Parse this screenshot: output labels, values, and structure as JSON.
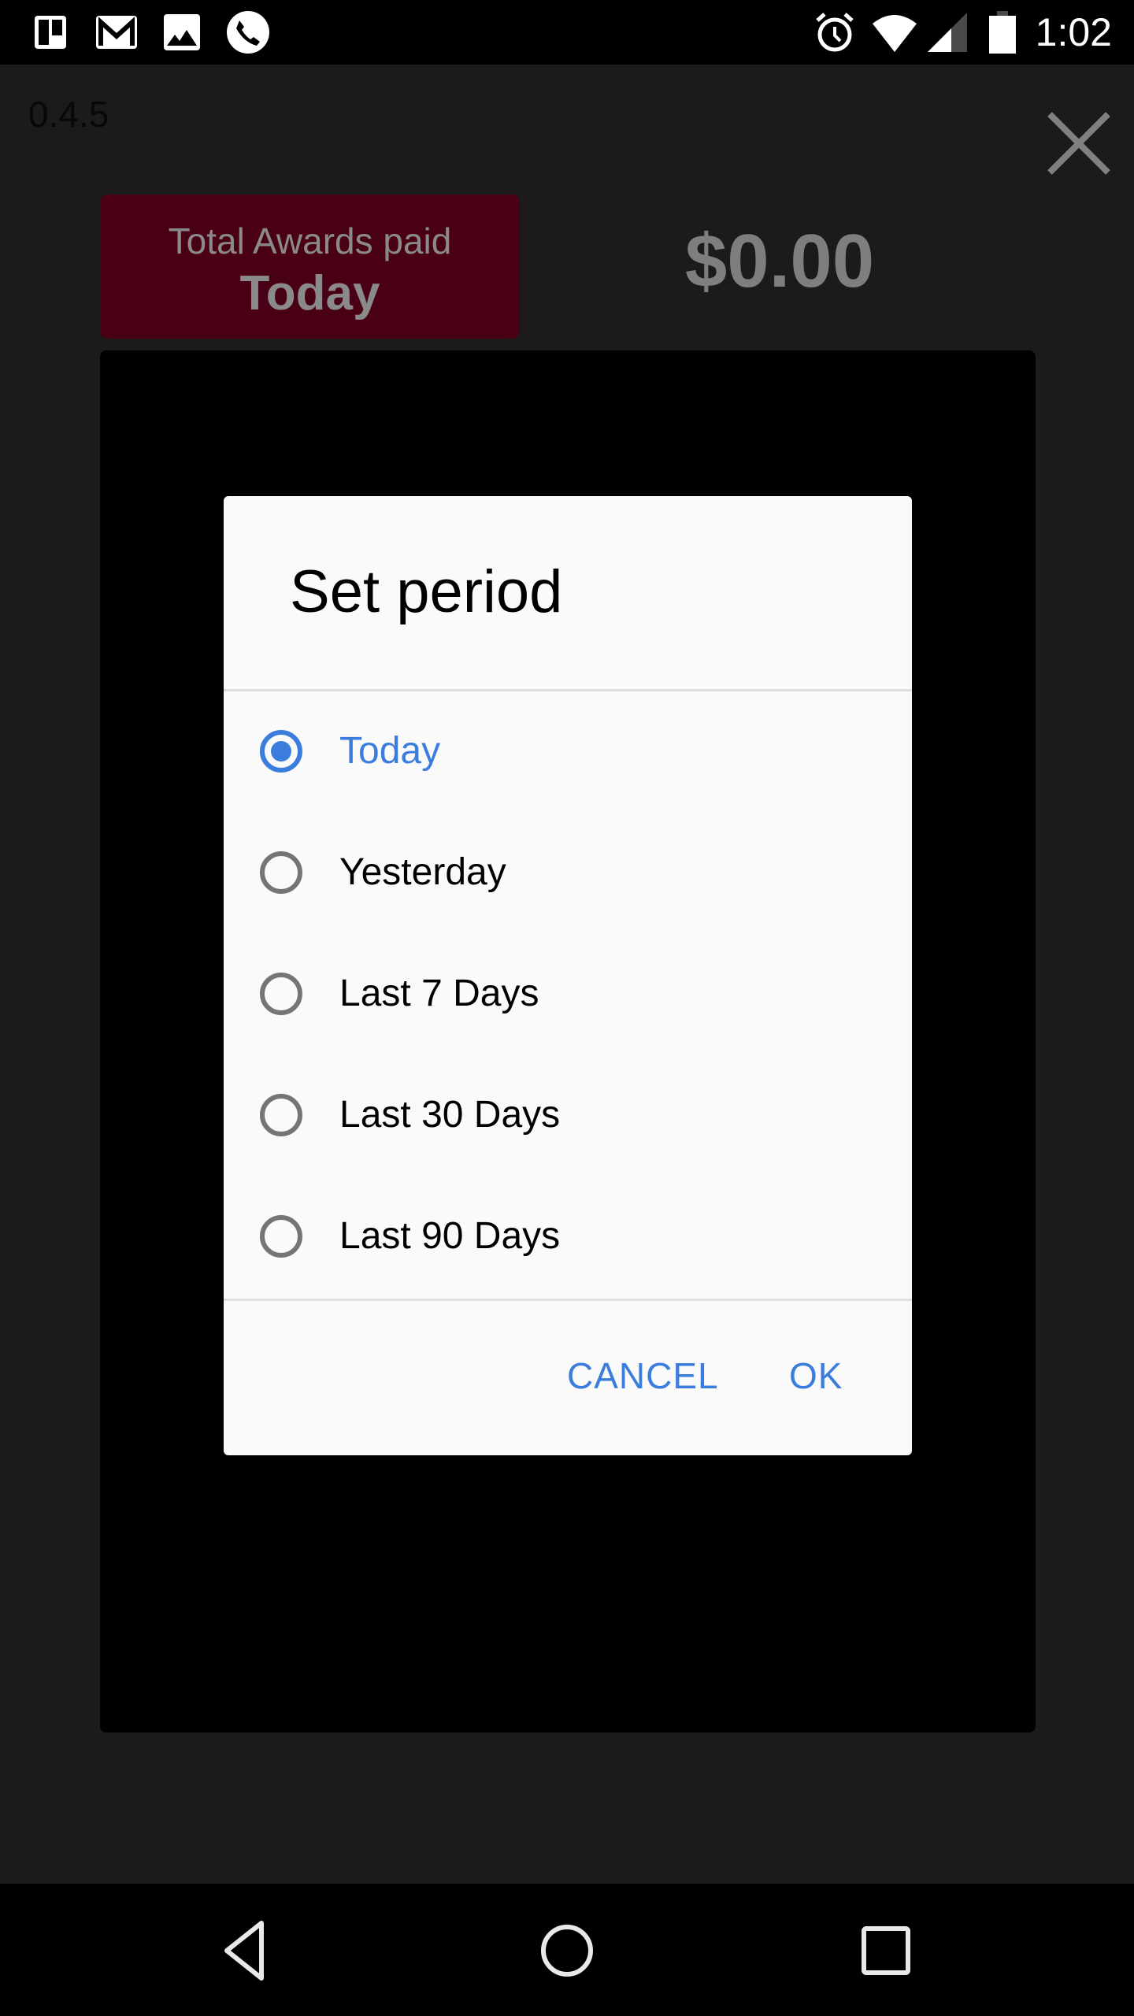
{
  "status_bar": {
    "left_icons": [
      "trello-icon",
      "gmail-icon",
      "gallery-icon",
      "phone-call-icon"
    ],
    "right_icons": [
      "alarm-icon",
      "wifi-icon",
      "cell-signal-icon",
      "battery-icon"
    ],
    "time": "1:02"
  },
  "app": {
    "version": "0.4.5",
    "banner": {
      "label": "Total Awards paid",
      "period": "Today"
    },
    "amount": "$0.00",
    "close_icon": "close-icon"
  },
  "dialog": {
    "title": "Set period",
    "options": [
      {
        "label": "Today",
        "selected": true
      },
      {
        "label": "Yesterday",
        "selected": false
      },
      {
        "label": "Last 7 Days",
        "selected": false
      },
      {
        "label": "Last 30 Days",
        "selected": false
      },
      {
        "label": "Last 90 Days",
        "selected": false
      }
    ],
    "cancel_label": "CANCEL",
    "ok_label": "OK"
  },
  "nav_bar": {
    "buttons": [
      "back-icon",
      "home-icon",
      "recents-icon"
    ]
  },
  "colors": {
    "accent": "#3b7ddd",
    "banner": "#4a0014",
    "dialog_bg": "#fafafa",
    "unselected_radio": "#757575"
  }
}
